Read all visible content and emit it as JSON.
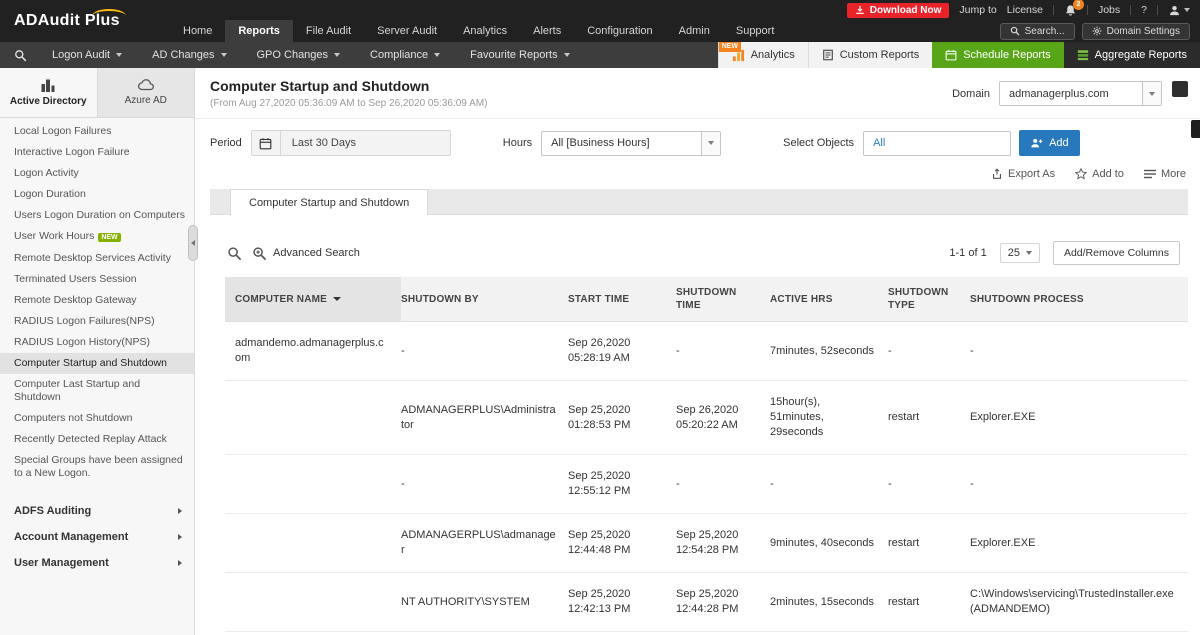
{
  "colors": {
    "accent_green": "#58a618",
    "add_blue": "#2878bd",
    "download_red": "#e8232a",
    "badge_orange": "#f5821f",
    "badge_green": "#85b200"
  },
  "topbar": {
    "logo": "ADAudit Plus",
    "utility": {
      "download": "Download Now",
      "jump_to": "Jump to",
      "license": "License",
      "bell_badge": "2",
      "jobs": "Jobs",
      "help": "?"
    },
    "nav": [
      "Home",
      "Reports",
      "File Audit",
      "Server Audit",
      "Analytics",
      "Alerts",
      "Configuration",
      "Admin",
      "Support"
    ],
    "search_label": "Search...",
    "domain_settings_label": "Domain Settings"
  },
  "subnav": {
    "menus": [
      "Logon Audit",
      "AD Changes",
      "GPO Changes",
      "Compliance",
      "Favourite Reports"
    ],
    "analytics_label": "Analytics",
    "analytics_badge": "NEW",
    "custom_reports_label": "Custom Reports",
    "schedule_reports_label": "Schedule Reports",
    "aggregate_reports_label": "Aggregate Reports"
  },
  "sidebar": {
    "tabs": [
      {
        "label": "Active Directory"
      },
      {
        "label": "Azure AD"
      }
    ],
    "items": [
      {
        "label": "Local Logon Failures"
      },
      {
        "label": "Interactive Logon Failure"
      },
      {
        "label": "Logon Activity"
      },
      {
        "label": "Logon Duration"
      },
      {
        "label": "Users Logon Duration on Computers"
      },
      {
        "label": "User Work Hours",
        "badge": "NEW"
      },
      {
        "label": "Remote Desktop Services Activity"
      },
      {
        "label": "Terminated Users Session"
      },
      {
        "label": "Remote Desktop Gateway"
      },
      {
        "label": "RADIUS Logon Failures(NPS)"
      },
      {
        "label": "RADIUS Logon History(NPS)"
      },
      {
        "label": "Computer Startup and Shutdown"
      },
      {
        "label": "Computer Last Startup and Shutdown"
      },
      {
        "label": "Computers not Shutdown"
      },
      {
        "label": "Recently Detected Replay Attack"
      },
      {
        "label": "Special Groups have been assigned to a New Logon."
      }
    ],
    "sections": [
      "ADFS Auditing",
      "Account Management",
      "User Management"
    ]
  },
  "report": {
    "title": "Computer Startup and Shutdown",
    "subtitle": "(From Aug 27,2020 05:36:09 AM to Sep 26,2020 05:36:09 AM)",
    "domain_label": "Domain",
    "domain_value": "admanagerplus.com",
    "filters": {
      "period_label": "Period",
      "period_value": "Last 30 Days",
      "hours_label": "Hours",
      "hours_value": "All [Business Hours]",
      "objects_label": "Select Objects",
      "objects_value": "All",
      "add_label": "Add"
    },
    "actions": {
      "export_label": "Export As",
      "add_to_label": "Add to",
      "more_label": "More"
    },
    "tab_label": "Computer Startup and Shutdown"
  },
  "table": {
    "advanced_search_label": "Advanced Search",
    "pagination": "1-1 of 1",
    "page_size": "25",
    "add_remove_columns_label": "Add/Remove Columns",
    "headers": [
      "COMPUTER NAME",
      "SHUTDOWN BY",
      "START TIME",
      "SHUTDOWN TIME",
      "ACTIVE HRS",
      "SHUTDOWN TYPE",
      "SHUTDOWN PROCESS"
    ],
    "rows": [
      [
        "admandemo.admanagerplus.com",
        "-",
        "Sep 26,2020\n05:28:19 AM",
        "-",
        "7minutes, 52seconds",
        "-",
        "-"
      ],
      [
        "",
        "ADMANAGERPLUS\\Administrator",
        "Sep 25,2020\n01:28:53 PM",
        "Sep 26,2020\n05:20:22 AM",
        "15hour(s), 51minutes, 29seconds",
        "restart",
        "Explorer.EXE"
      ],
      [
        "",
        "-",
        "Sep 25,2020\n12:55:12 PM",
        "-",
        "-",
        "-",
        "-"
      ],
      [
        "",
        "ADMANAGERPLUS\\admanager",
        "Sep 25,2020\n12:44:48 PM",
        "Sep 25,2020\n12:54:28 PM",
        "9minutes, 40seconds",
        "restart",
        "Explorer.EXE"
      ],
      [
        "",
        "NT AUTHORITY\\SYSTEM",
        "Sep 25,2020\n12:42:13 PM",
        "Sep 25,2020\n12:44:28 PM",
        "2minutes, 15seconds",
        "restart",
        "C:\\Windows\\servicing\\TrustedInstaller.exe (ADMANDEMO)"
      ]
    ]
  }
}
